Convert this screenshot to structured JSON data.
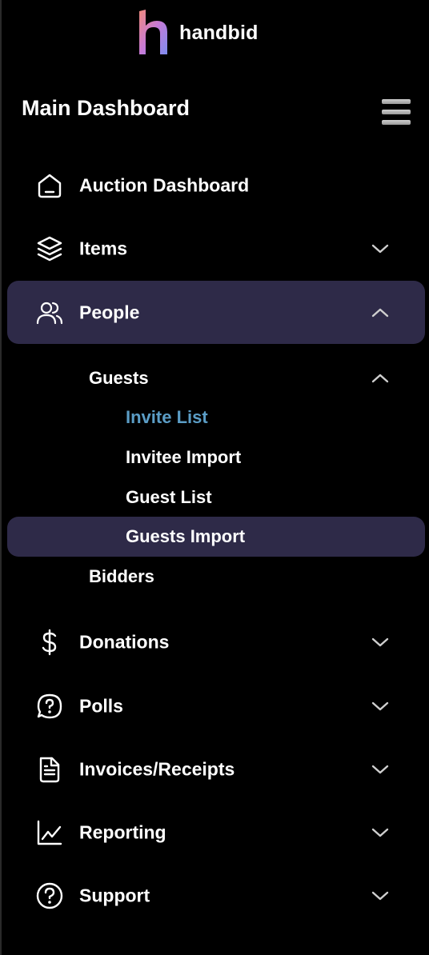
{
  "brand": {
    "name": "handbid",
    "colors": {
      "logo_gradient_start": "#f08a7e",
      "logo_gradient_mid": "#c77ad6",
      "logo_gradient_end": "#7d8cf0"
    },
    "icon": "handbid-h-logo"
  },
  "header": {
    "title": "Main Dashboard",
    "menu_icon": "hamburger-menu-icon"
  },
  "colors": {
    "background": "#000000",
    "active_row": "#2e2a48",
    "link_highlight": "#5b9dc6",
    "text": "#ffffff"
  },
  "nav": {
    "items": [
      {
        "label": "Auction Dashboard",
        "icon": "home-icon",
        "expandable": false,
        "active": false
      },
      {
        "label": "Items",
        "icon": "layers-icon",
        "expandable": true,
        "expanded": false,
        "active": false
      },
      {
        "label": "People",
        "icon": "users-icon",
        "expandable": true,
        "expanded": true,
        "active": true
      },
      {
        "label": "Donations",
        "icon": "dollar-icon",
        "expandable": true,
        "expanded": false,
        "active": false
      },
      {
        "label": "Polls",
        "icon": "question-bubble-icon",
        "expandable": true,
        "expanded": false,
        "active": false
      },
      {
        "label": "Invoices/Receipts",
        "icon": "document-icon",
        "expandable": true,
        "expanded": false,
        "active": false
      },
      {
        "label": "Reporting",
        "icon": "chart-line-icon",
        "expandable": true,
        "expanded": false,
        "active": false
      },
      {
        "label": "Support",
        "icon": "help-circle-icon",
        "expandable": true,
        "expanded": false,
        "active": false
      }
    ]
  },
  "people_submenu": {
    "guests": {
      "label": "Guests",
      "expanded": true,
      "items": [
        {
          "label": "Invite List",
          "highlighted": true,
          "active": false
        },
        {
          "label": "Invitee Import",
          "highlighted": false,
          "active": false
        },
        {
          "label": "Guest List",
          "highlighted": false,
          "active": false
        },
        {
          "label": "Guests Import",
          "highlighted": false,
          "active": true
        }
      ]
    },
    "bidders": {
      "label": "Bidders"
    }
  }
}
